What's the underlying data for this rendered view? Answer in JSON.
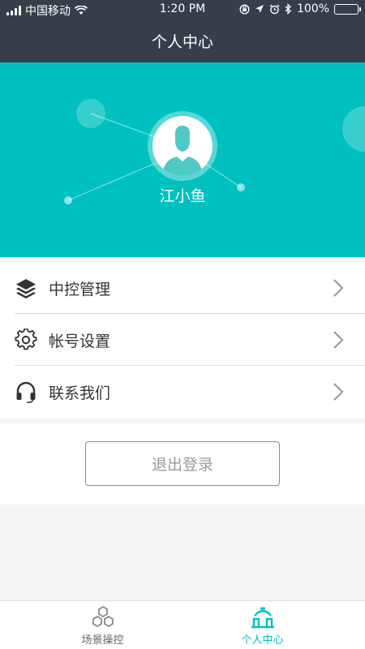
{
  "status_bar": {
    "carrier": "中国移动",
    "time": "1:20 PM",
    "battery": "100%",
    "battery_level": 1.0
  },
  "navbar": {
    "title": "个人中心"
  },
  "profile": {
    "username": "江小鱼"
  },
  "menu": {
    "items": [
      {
        "label": "中控管理",
        "icon": "layers-icon"
      },
      {
        "label": "帐号设置",
        "icon": "gear-icon"
      },
      {
        "label": "联系我们",
        "icon": "headset-icon"
      }
    ]
  },
  "logout": {
    "label": "退出登录"
  },
  "tabbar": {
    "tabs": [
      {
        "label": "场景操控",
        "icon": "hexagons-icon",
        "active": false
      },
      {
        "label": "个人中心",
        "icon": "home-icon",
        "active": true
      }
    ]
  },
  "colors": {
    "header": "#353e49",
    "accent": "#00c1c0",
    "text": "#333333",
    "inactive": "#666666"
  }
}
